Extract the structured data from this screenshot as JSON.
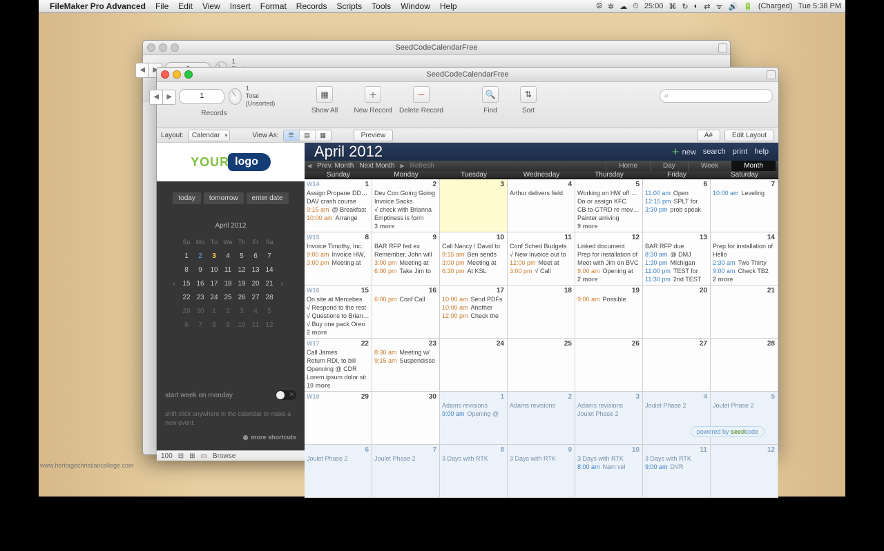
{
  "menubar": {
    "app": "FileMaker Pro Advanced",
    "items": [
      "File",
      "Edit",
      "View",
      "Insert",
      "Format",
      "Records",
      "Scripts",
      "Tools",
      "Window",
      "Help"
    ],
    "status": {
      "timer": "25:00",
      "battery": "(Charged)",
      "clock": "Tue 5:38 PM"
    }
  },
  "windows": {
    "back_title": "SeedCodeCalendarFree",
    "front_title": "SeedCodeCalendarFree"
  },
  "toolbar": {
    "record_value": "1",
    "record_total": "1",
    "record_state": "Total (Unsorted)",
    "records_label": "Records",
    "items": {
      "showall": "Show All",
      "newrec": "New Record",
      "delrec": "Delete Record",
      "find": "Find",
      "sort": "Sort"
    },
    "search_placeholder": ""
  },
  "layoutbar": {
    "layout_label": "Layout:",
    "layout_value": "Calendar",
    "viewas_label": "View As:",
    "preview": "Preview",
    "aa": "A#",
    "editlayout": "Edit Layout"
  },
  "sidebar": {
    "logo_your": "YOUR",
    "logo_badge": "logo",
    "btns": {
      "today": "today",
      "tomorrow": "tomorrow",
      "enter": "enter date"
    },
    "mini": {
      "title": "April 2012",
      "dow": [
        "Su",
        "Mo",
        "Tu",
        "We",
        "Th",
        "Fr",
        "Sa"
      ],
      "rows": [
        [
          "1",
          "2",
          "3",
          "4",
          "5",
          "6",
          "7"
        ],
        [
          "8",
          "9",
          "10",
          "11",
          "12",
          "13",
          "14"
        ],
        [
          "15",
          "16",
          "17",
          "18",
          "19",
          "20",
          "21"
        ],
        [
          "22",
          "23",
          "24",
          "25",
          "26",
          "27",
          "28"
        ],
        [
          "29",
          "30",
          "1",
          "2",
          "3",
          "4",
          "5"
        ],
        [
          "6",
          "7",
          "8",
          "9",
          "10",
          "11",
          "12"
        ]
      ],
      "hl": "2",
      "today": "3"
    },
    "switch_label": "start week on monday",
    "tip": "shift-click anywhere in the calendar to make a new event.",
    "more": "more shortcuts"
  },
  "calendar": {
    "title": "April 2012",
    "buttons": {
      "new": "new",
      "search": "search",
      "print": "print",
      "help": "help"
    },
    "nav": {
      "prev": "Prev. Month",
      "next": "Next Month",
      "refresh": "Refresh"
    },
    "views": {
      "home": "Home",
      "day": "Day",
      "week": "Week",
      "month": "Month"
    },
    "dow": [
      "Sunday",
      "Monday",
      "Tuesday",
      "Wednesday",
      "Thursday",
      "Friday",
      "Saturday"
    ],
    "weeks": [
      "W14",
      "W15",
      "W16",
      "W17",
      "W18",
      "",
      ""
    ],
    "cells": [
      [
        {
          "n": "1",
          "ev": [
            {
              "x": "Assign Propane DDBC"
            },
            {
              "x": "DAV crash course"
            },
            {
              "t": "9:15 am",
              "x": "@ Breakfast"
            },
            {
              "t": "10:00 am",
              "x": "Arrange"
            }
          ]
        },
        {
          "n": "2",
          "ev": [
            {
              "x": "Dev Con Going Going"
            },
            {
              "x": "Invoice Sacks"
            },
            {
              "x": "√ check with Brianna"
            },
            {
              "x": "Emptiness is form"
            }
          ],
          "more": "3 more"
        },
        {
          "n": "3",
          "today": true,
          "ev": []
        },
        {
          "n": "4",
          "ev": [
            {
              "x": "Arthur delivers field"
            }
          ]
        },
        {
          "n": "5",
          "ev": [
            {
              "x": "Working on HW off site"
            },
            {
              "x": "Do or assign KFC"
            },
            {
              "x": "CB to GTRD re moving"
            },
            {
              "x": "Painter arriving"
            }
          ],
          "more": "9 more"
        },
        {
          "n": "6",
          "ev": [
            {
              "t2": "11:00 am",
              "x": "Open"
            },
            {
              "t2": "12:15 pm",
              "x": "SPLT for"
            },
            {
              "t2": "3:30 pm",
              "x": "prob speak"
            }
          ]
        },
        {
          "n": "7",
          "ev": [
            {
              "t2": "10:00 am",
              "x": "Leveling"
            }
          ]
        }
      ],
      [
        {
          "n": "8",
          "ev": [
            {
              "x": "Invoice Timothy, Inc."
            },
            {
              "t": "9:00 am",
              "x": "Invoice HW,"
            },
            {
              "t": "3:00 pm",
              "x": "Meeting at"
            }
          ]
        },
        {
          "n": "9",
          "ev": [
            {
              "x": "BAR RFP fed ex"
            },
            {
              "x": "Remember, John will"
            },
            {
              "t": "3:00 pm",
              "x": "Meeting at"
            },
            {
              "t": "6:00 pm",
              "x": "Take Jim to"
            }
          ]
        },
        {
          "n": "10",
          "ev": [
            {
              "x": "Call Nancy / David to"
            },
            {
              "t": "9:15 am",
              "x": "Ben sends"
            },
            {
              "t": "3:00 pm",
              "x": "Meeting at"
            },
            {
              "t": "6:30 pm",
              "x": "At KSL"
            }
          ]
        },
        {
          "n": "11",
          "ev": [
            {
              "x": "Conf Sched Budgets"
            },
            {
              "x": "√ New Invoice out to"
            },
            {
              "t": "12:00 pm",
              "x": "Meet at"
            },
            {
              "t": "3:00 pm",
              "x": "√ Call"
            }
          ]
        },
        {
          "n": "12",
          "ev": [
            {
              "x": "Linked document"
            },
            {
              "x": "Prep for installation of"
            },
            {
              "x": "Meet with Jim on BVC"
            },
            {
              "t": "9:00 am",
              "x": "Opening at"
            }
          ],
          "more": "2 more"
        },
        {
          "n": "13",
          "ev": [
            {
              "x": "BAR RFP due"
            },
            {
              "t2": "8:30 am",
              "x": "@ DMJ"
            },
            {
              "t2": "1:30 pm",
              "x": "Michigan"
            },
            {
              "t2": "11:00 pm",
              "x": "TEST for"
            },
            {
              "t2": "11:30 pm",
              "x": "2nd TEST"
            }
          ]
        },
        {
          "n": "14",
          "ev": [
            {
              "x": "Prep for installation of"
            },
            {
              "x": "Hello"
            },
            {
              "t2": "2:30 am",
              "x": "Two Thirty"
            },
            {
              "t2": "9:00 am",
              "x": "Check TB2"
            }
          ],
          "more": "2 more"
        }
      ],
      [
        {
          "n": "15",
          "ev": [
            {
              "x": "On site at Mercebes"
            },
            {
              "x": "√ Respond to the rest"
            },
            {
              "x": "√ Questions to Brianna"
            },
            {
              "x": "√ Buy one pack Oreo"
            }
          ],
          "more": "2 more"
        },
        {
          "n": "16",
          "ev": [
            {
              "t": "6:00 pm",
              "x": "Conf Call"
            }
          ]
        },
        {
          "n": "17",
          "ev": [
            {
              "t": "10:00 am",
              "x": "Send PDFs"
            },
            {
              "t": "10:00 am",
              "x": "Another"
            },
            {
              "t": "12:00 pm",
              "x": "Check the"
            }
          ]
        },
        {
          "n": "18",
          "ev": []
        },
        {
          "n": "19",
          "ev": [
            {
              "t": "9:00 am",
              "x": "Possible"
            }
          ]
        },
        {
          "n": "20",
          "ev": []
        },
        {
          "n": "21",
          "ev": []
        }
      ],
      [
        {
          "n": "22",
          "ev": [
            {
              "x": "Call James"
            },
            {
              "x": "Return RDI, to bill"
            },
            {
              "x": "Openning @ CDR"
            },
            {
              "x": "Lorem ipsum dolor sit"
            }
          ],
          "more": "10 more"
        },
        {
          "n": "23",
          "ev": [
            {
              "t": "8:30 am",
              "x": "Meeting w/"
            },
            {
              "t": "9:15 am",
              "x": "Suspendisse"
            }
          ]
        },
        {
          "n": "24",
          "ev": []
        },
        {
          "n": "25",
          "ev": []
        },
        {
          "n": "26",
          "ev": []
        },
        {
          "n": "27",
          "ev": []
        },
        {
          "n": "28",
          "ev": []
        }
      ],
      [
        {
          "n": "29",
          "ev": []
        },
        {
          "n": "30",
          "ev": []
        },
        {
          "n": "1",
          "f": true,
          "ev": [
            {
              "x": "Adams revisions"
            },
            {
              "t2": "9:00 am",
              "x": "Opening @"
            }
          ]
        },
        {
          "n": "2",
          "f": true,
          "ev": [
            {
              "x": "Adams revisions"
            }
          ]
        },
        {
          "n": "3",
          "f": true,
          "ev": [
            {
              "x": "Adams revisions"
            },
            {
              "x": "Joulet Phase 2"
            }
          ]
        },
        {
          "n": "4",
          "f": true,
          "ev": [
            {
              "x": "Joulet Phase 2"
            }
          ]
        },
        {
          "n": "5",
          "f": true,
          "ev": [
            {
              "x": "Joulet Phase 2"
            }
          ]
        }
      ],
      [
        {
          "n": "6",
          "f": true,
          "ev": [
            {
              "x": "Joulet Phase 2"
            }
          ]
        },
        {
          "n": "7",
          "f": true,
          "ev": [
            {
              "x": "Joulet Phase 2"
            }
          ]
        },
        {
          "n": "8",
          "f": true,
          "ev": [
            {
              "x": "3 Days with RTK"
            }
          ]
        },
        {
          "n": "9",
          "f": true,
          "ev": [
            {
              "x": "3 Days with RTK"
            }
          ]
        },
        {
          "n": "10",
          "f": true,
          "ev": [
            {
              "x": "3 Days with RTK"
            },
            {
              "t2": "8:00 am",
              "x": "Nam vel"
            }
          ]
        },
        {
          "n": "11",
          "f": true,
          "ev": [
            {
              "x": "3 Days with RTK"
            },
            {
              "t2": "9:00 am",
              "x": "DVR"
            }
          ]
        },
        {
          "n": "12",
          "f": true,
          "ev": []
        }
      ]
    ]
  },
  "footer": {
    "zoom": "100",
    "mode": "Browse"
  },
  "powered": {
    "pre": "powered by ",
    "brand": "seed",
    "brand2": "code"
  },
  "watermark": "www.heritagechristiancollege.com"
}
